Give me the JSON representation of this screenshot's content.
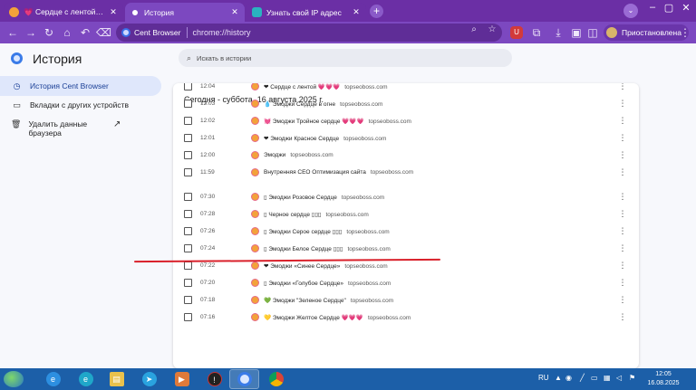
{
  "tabs": [
    {
      "title": "💗 Сердце с лентой 💗💗💗",
      "active": false
    },
    {
      "title": "История",
      "active": true
    },
    {
      "title": "Узнать свой IP адрес",
      "active": false
    }
  ],
  "toolbar": {
    "brand": "Cent Browser",
    "url": "chrome://history",
    "ext_badge": "U",
    "profile_status": "Приостановлена"
  },
  "page": {
    "title": "История",
    "search_placeholder": "Искать в истории"
  },
  "sidebar": {
    "items": [
      {
        "label": "История Cent Browser",
        "icon": "history-icon"
      },
      {
        "label": "Вкладки с других устройств",
        "icon": "devices-icon"
      },
      {
        "label": "Удалить данные браузера",
        "icon": "trash-icon"
      }
    ]
  },
  "history": {
    "day_title": "Сегодня - суббота, 16 августа 2025 г.",
    "entries": [
      {
        "time": "12:04",
        "title": "❤ Сердце с лентой 💗💗💗",
        "domain": "topseoboss.com"
      },
      {
        "time": "12:03",
        "title": "💧 Эмоджи Сердце в огне",
        "domain": "topseoboss.com"
      },
      {
        "time": "12:02",
        "title": "💓 Эмоджи Тройное сердце 💗💗💗",
        "domain": "topseoboss.com"
      },
      {
        "time": "12:01",
        "title": "❤ Эмоджи Красное Сердце",
        "domain": "topseoboss.com"
      },
      {
        "time": "12:00",
        "title": "Эмоджи",
        "domain": "topseoboss.com"
      },
      {
        "time": "11:59",
        "title": "Внутренняя СЕО Оптимизация сайта",
        "domain": "topseoboss.com"
      },
      {
        "time": "07:30",
        "title": "▯ Эмоджи Розовое Сердце",
        "domain": "topseoboss.com"
      },
      {
        "time": "07:28",
        "title": "▯ Черное сердце ▯▯▯",
        "domain": "topseoboss.com"
      },
      {
        "time": "07:26",
        "title": "▯ Эмоджи Серое сердце ▯▯▯",
        "domain": "topseoboss.com"
      },
      {
        "time": "07:24",
        "title": "▯ Эмоджи Белое Сердце ▯▯▯",
        "domain": "topseoboss.com"
      },
      {
        "time": "07:22",
        "title": "❤ Эмоджи «Синее Сердце»",
        "domain": "topseoboss.com"
      },
      {
        "time": "07:20",
        "title": "▯ Эмоджи «Голубое Сердце»",
        "domain": "topseoboss.com"
      },
      {
        "time": "07:18",
        "title": "💚 Эмоджи \"Зеленое Сердце\"",
        "domain": "topseoboss.com"
      },
      {
        "time": "07:16",
        "title": "💛 Эмоджи Желтое Сердце 💗💗💗",
        "domain": "topseoboss.com"
      }
    ]
  },
  "taskbar": {
    "lang": "RU",
    "time": "12:05",
    "date": "16.08.2025"
  }
}
